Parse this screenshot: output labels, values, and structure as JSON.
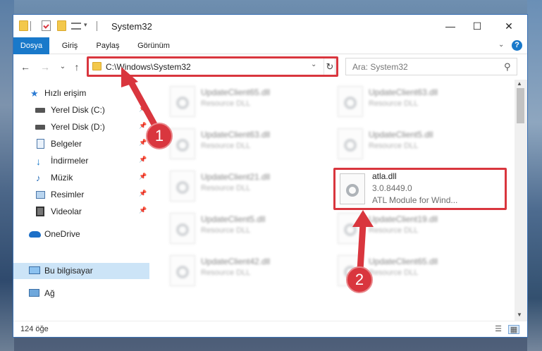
{
  "window": {
    "title": "System32",
    "controls": {
      "minimize": "—",
      "maximize": "☐",
      "close": "✕"
    }
  },
  "ribbon": {
    "tabs": [
      {
        "label": "Dosya",
        "active": true
      },
      {
        "label": "Giriş"
      },
      {
        "label": "Paylaş"
      },
      {
        "label": "Görünüm"
      }
    ],
    "help": "?"
  },
  "navigation": {
    "back": "←",
    "forward": "→",
    "recent": "⌄",
    "up": "↑",
    "address": "C:\\Windows\\System32",
    "search_placeholder": "Ara: System32"
  },
  "sidebar": {
    "items": [
      {
        "label": "Hızlı erişim",
        "icon": "star-icon"
      },
      {
        "label": "Yerel Disk (C:)",
        "icon": "drive-icon",
        "pinned": true
      },
      {
        "label": "Yerel Disk (D:)",
        "icon": "drive-icon",
        "pinned": true
      },
      {
        "label": "Belgeler",
        "icon": "documents-icon",
        "pinned": true
      },
      {
        "label": "İndirmeler",
        "icon": "download-icon",
        "pinned": true
      },
      {
        "label": "Müzik",
        "icon": "music-icon",
        "pinned": true
      },
      {
        "label": "Resimler",
        "icon": "pictures-icon",
        "pinned": true
      },
      {
        "label": "Videolar",
        "icon": "videos-icon",
        "pinned": true
      },
      {
        "label": "OneDrive",
        "icon": "cloud-icon"
      },
      {
        "label": "Bu bilgisayar",
        "icon": "computer-icon",
        "selected": true
      },
      {
        "label": "Ağ",
        "icon": "network-icon"
      }
    ]
  },
  "files": {
    "left": [
      {
        "name": "UpdateClient65.dll",
        "desc": "Resource DLL"
      },
      {
        "name": "UpdateClient63.dll",
        "desc": "Resource DLL"
      },
      {
        "name": "UpdateClient21.dll",
        "desc": "Resource DLL"
      },
      {
        "name": "UpdateClient5.dll",
        "desc": "Resource DLL"
      },
      {
        "name": "UpdateClient42.dll",
        "desc": "Resource DLL"
      }
    ],
    "right": [
      {
        "name": "UpdateClient63.dll",
        "desc": "Resource DLL"
      },
      {
        "name": "UpdateClient5.dll",
        "desc": "Resource DLL"
      },
      {
        "name": "UpdateClient19.dll",
        "desc": "Resource DLL"
      },
      {
        "name": "UpdateClient65.dll",
        "desc": "Resource DLL"
      }
    ],
    "highlighted": {
      "name": "atla.dll",
      "version": "3.0.8449.0",
      "desc": "ATL Module for Wind..."
    }
  },
  "status": {
    "count": "124 öğe"
  },
  "annotations": {
    "step1": "1",
    "step2": "2",
    "color": "#d9363e"
  }
}
